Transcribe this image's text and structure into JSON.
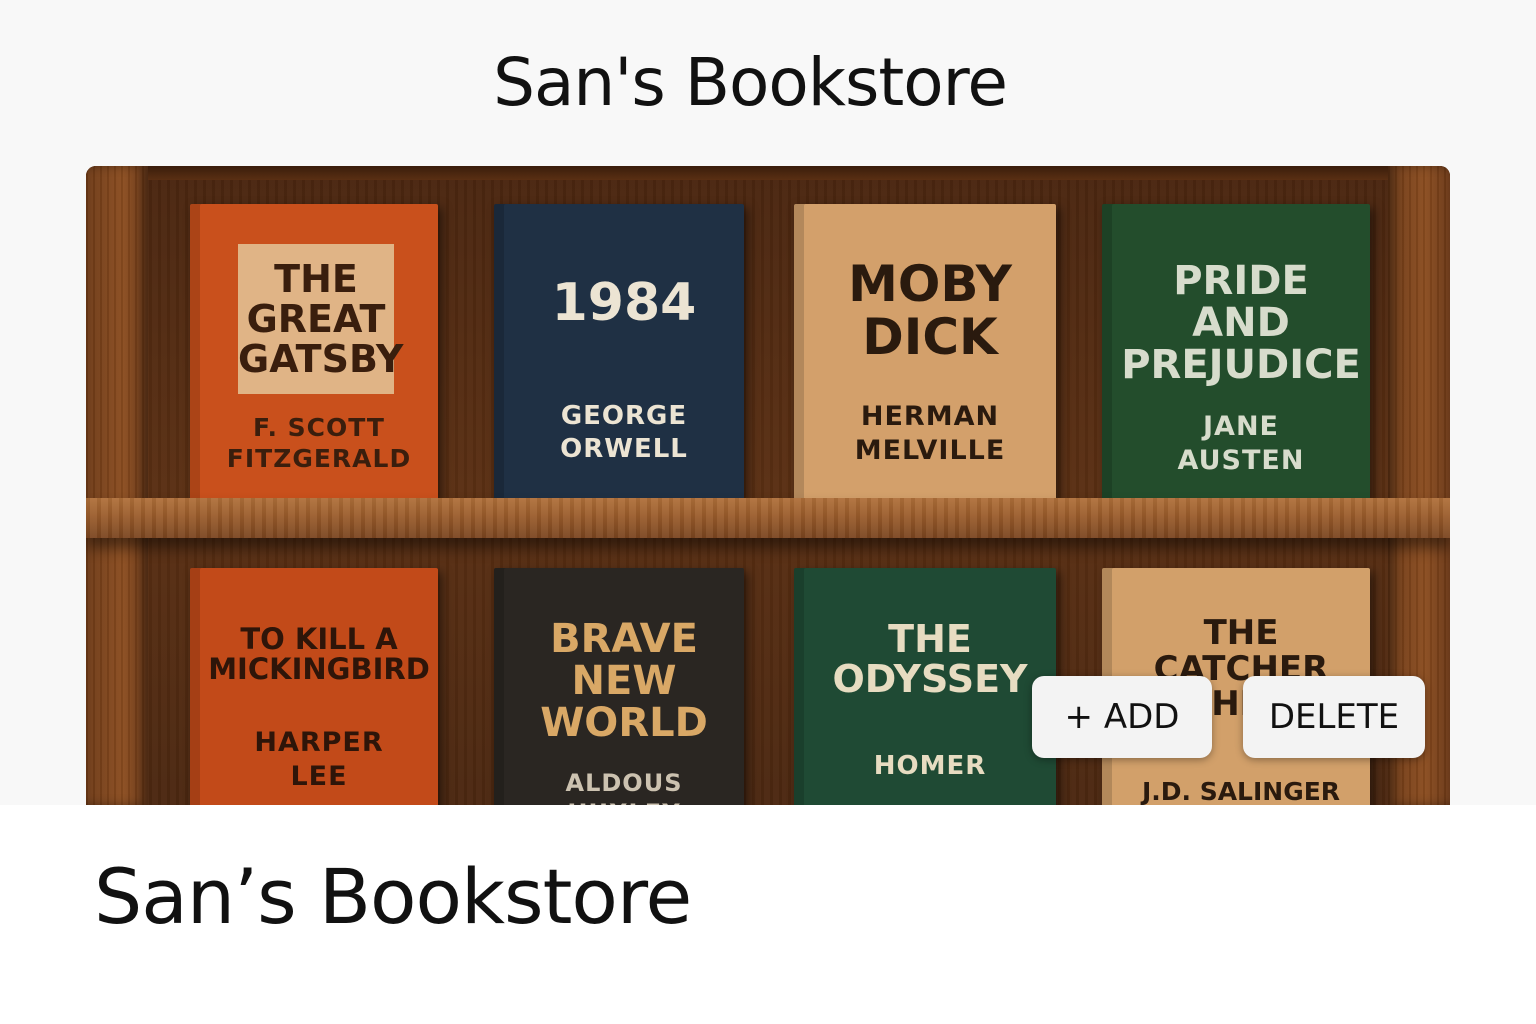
{
  "header": {
    "title": "San's Bookstore"
  },
  "shelf": {
    "rows": [
      {
        "books": [
          {
            "title": "THE\nGREAT\nGATSBY",
            "author": "F. SCOTT\nFITZGERALD",
            "color": "#c9501c",
            "text_color": "#3a1e0d",
            "author_color": "#3a1e0d"
          },
          {
            "title": "1984",
            "author": "GEORGE\nORWELL",
            "color": "#1f3044",
            "text_color": "#ece4d3",
            "author_color": "#ece4d3"
          },
          {
            "title": "MOBY\nDICK",
            "author": "HERMAN\nMELVILLE",
            "color": "#d3a06b",
            "text_color": "#2a1a0e",
            "author_color": "#2a1a0e"
          },
          {
            "title": "PRIDE\nAND\nPREJUDICE",
            "author": "JANE\nAUSTEN",
            "color": "#234d2c",
            "text_color": "#d7dccc",
            "author_color": "#d7dccc"
          }
        ]
      },
      {
        "books": [
          {
            "title": "TO KILL A\nMICKINGBIRD",
            "author": "HARPER\nLEE",
            "color": "#c24a19",
            "text_color": "#2e1509",
            "author_color": "#2e1509"
          },
          {
            "title": "BRAVE\nNEW\nWORLD",
            "author": "ALDOUS\nHUXLEY",
            "color": "#2a2622",
            "text_color": "#d9a866",
            "author_color": "#ccc2b0"
          },
          {
            "title": "THE\nODYSSEY",
            "author": "HOMER",
            "color": "#1f4a34",
            "text_color": "#e7dcc1",
            "author_color": "#e7dcc1"
          },
          {
            "title": "THE\nCATCHER\nIN THE RYE",
            "author": "J.D. SALINGER",
            "color": "#d2a06a",
            "text_color": "#2a1a0e",
            "author_color": "#2a1a0e"
          }
        ]
      }
    ]
  },
  "actions": {
    "add_label": "+ ADD",
    "delete_label": "DELETE"
  },
  "footer": {
    "title": "San’s Bookstore"
  }
}
